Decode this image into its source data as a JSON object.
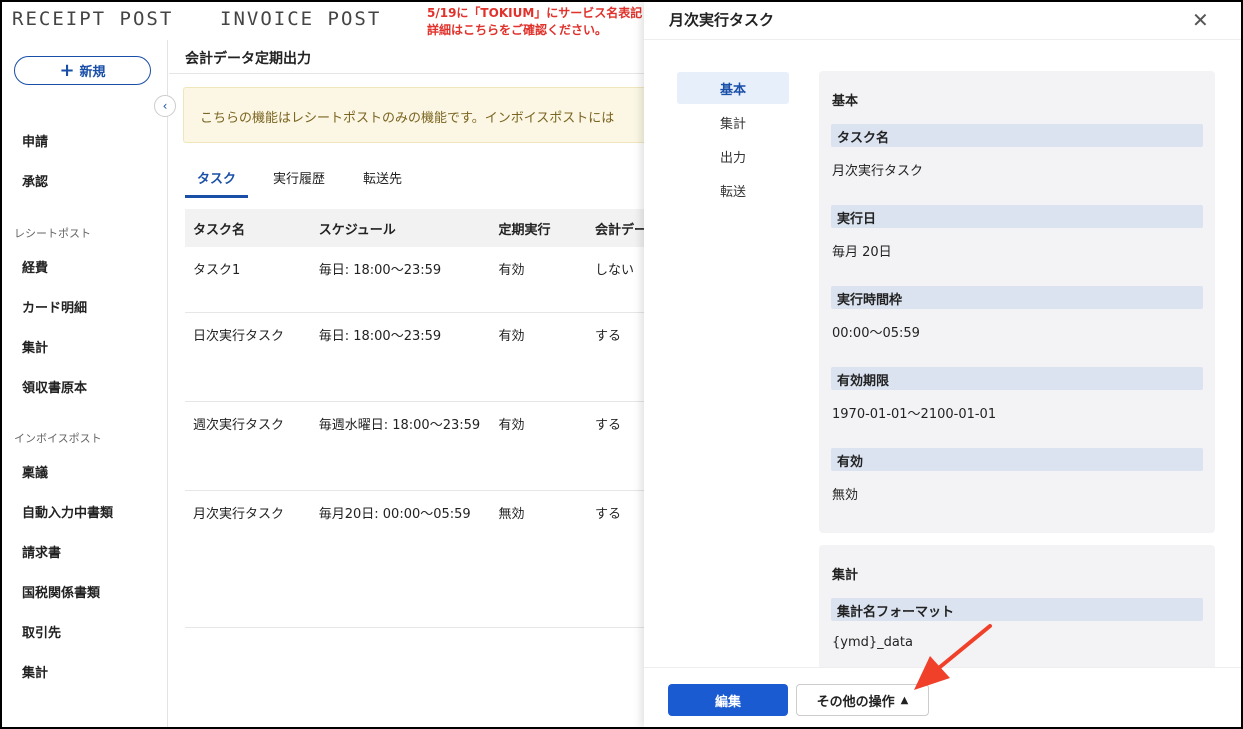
{
  "topbar": {
    "logo_receipt": "RECEIPT POST",
    "logo_invoice": "INVOICE POST",
    "announce_line1": "5/19に「TOKIUM」にサービス名表記",
    "announce_line2": "詳細はこちらをご確認ください。"
  },
  "sidebar": {
    "new_label": "新規",
    "items_top": [
      "申請",
      "承認"
    ],
    "section_receipt": "レシートポスト",
    "items_receipt": [
      "経費",
      "カード明細",
      "集計",
      "領収書原本"
    ],
    "section_invoice": "インボイスポスト",
    "items_invoice": [
      "稟議",
      "自動入力中書類",
      "請求書",
      "国税関係書類",
      "取引先",
      "集計"
    ]
  },
  "main": {
    "title": "会計データ定期出力",
    "notice": "こちらの機能はレシートポストのみの機能です。インボイスポストには",
    "tabs": [
      "タスク",
      "実行履歴",
      "転送先"
    ],
    "table": {
      "headers": [
        "タスク名",
        "スケジュール",
        "定期実行",
        "会計デー"
      ],
      "rows": [
        [
          "タスク1",
          "毎日: 18:00〜23:59",
          "有効",
          "しない"
        ],
        [
          "日次実行タスク",
          "毎日: 18:00〜23:59",
          "有効",
          "する"
        ],
        [
          "週次実行タスク",
          "毎週水曜日: 18:00〜23:59",
          "有効",
          "する"
        ],
        [
          "月次実行タスク",
          "毎月20日: 00:00〜05:59",
          "無効",
          "する"
        ]
      ]
    }
  },
  "panel": {
    "title": "月次実行タスク",
    "close": "✕",
    "side_tabs": [
      "基本",
      "集計",
      "出力",
      "転送"
    ],
    "basic": {
      "title": "基本",
      "fields": [
        {
          "label": "タスク名",
          "value": "月次実行タスク"
        },
        {
          "label": "実行日",
          "value": "毎月 20日"
        },
        {
          "label": "実行時間枠",
          "value": "00:00〜05:59"
        },
        {
          "label": "有効期限",
          "value": "1970-01-01〜2100-01-01"
        },
        {
          "label": "有効",
          "value": "無効"
        }
      ]
    },
    "aggregate": {
      "title": "集計",
      "fields": [
        {
          "label": "集計名フォーマット",
          "value": "{ymd}_data"
        }
      ]
    },
    "footer": {
      "edit_label": "編集",
      "other_label": "その他の操作"
    }
  },
  "colors": {
    "accent": "#1a4fa8",
    "primary_button": "#1a5bd1",
    "announce": "#e0312b",
    "arrow": "#f0402a"
  }
}
